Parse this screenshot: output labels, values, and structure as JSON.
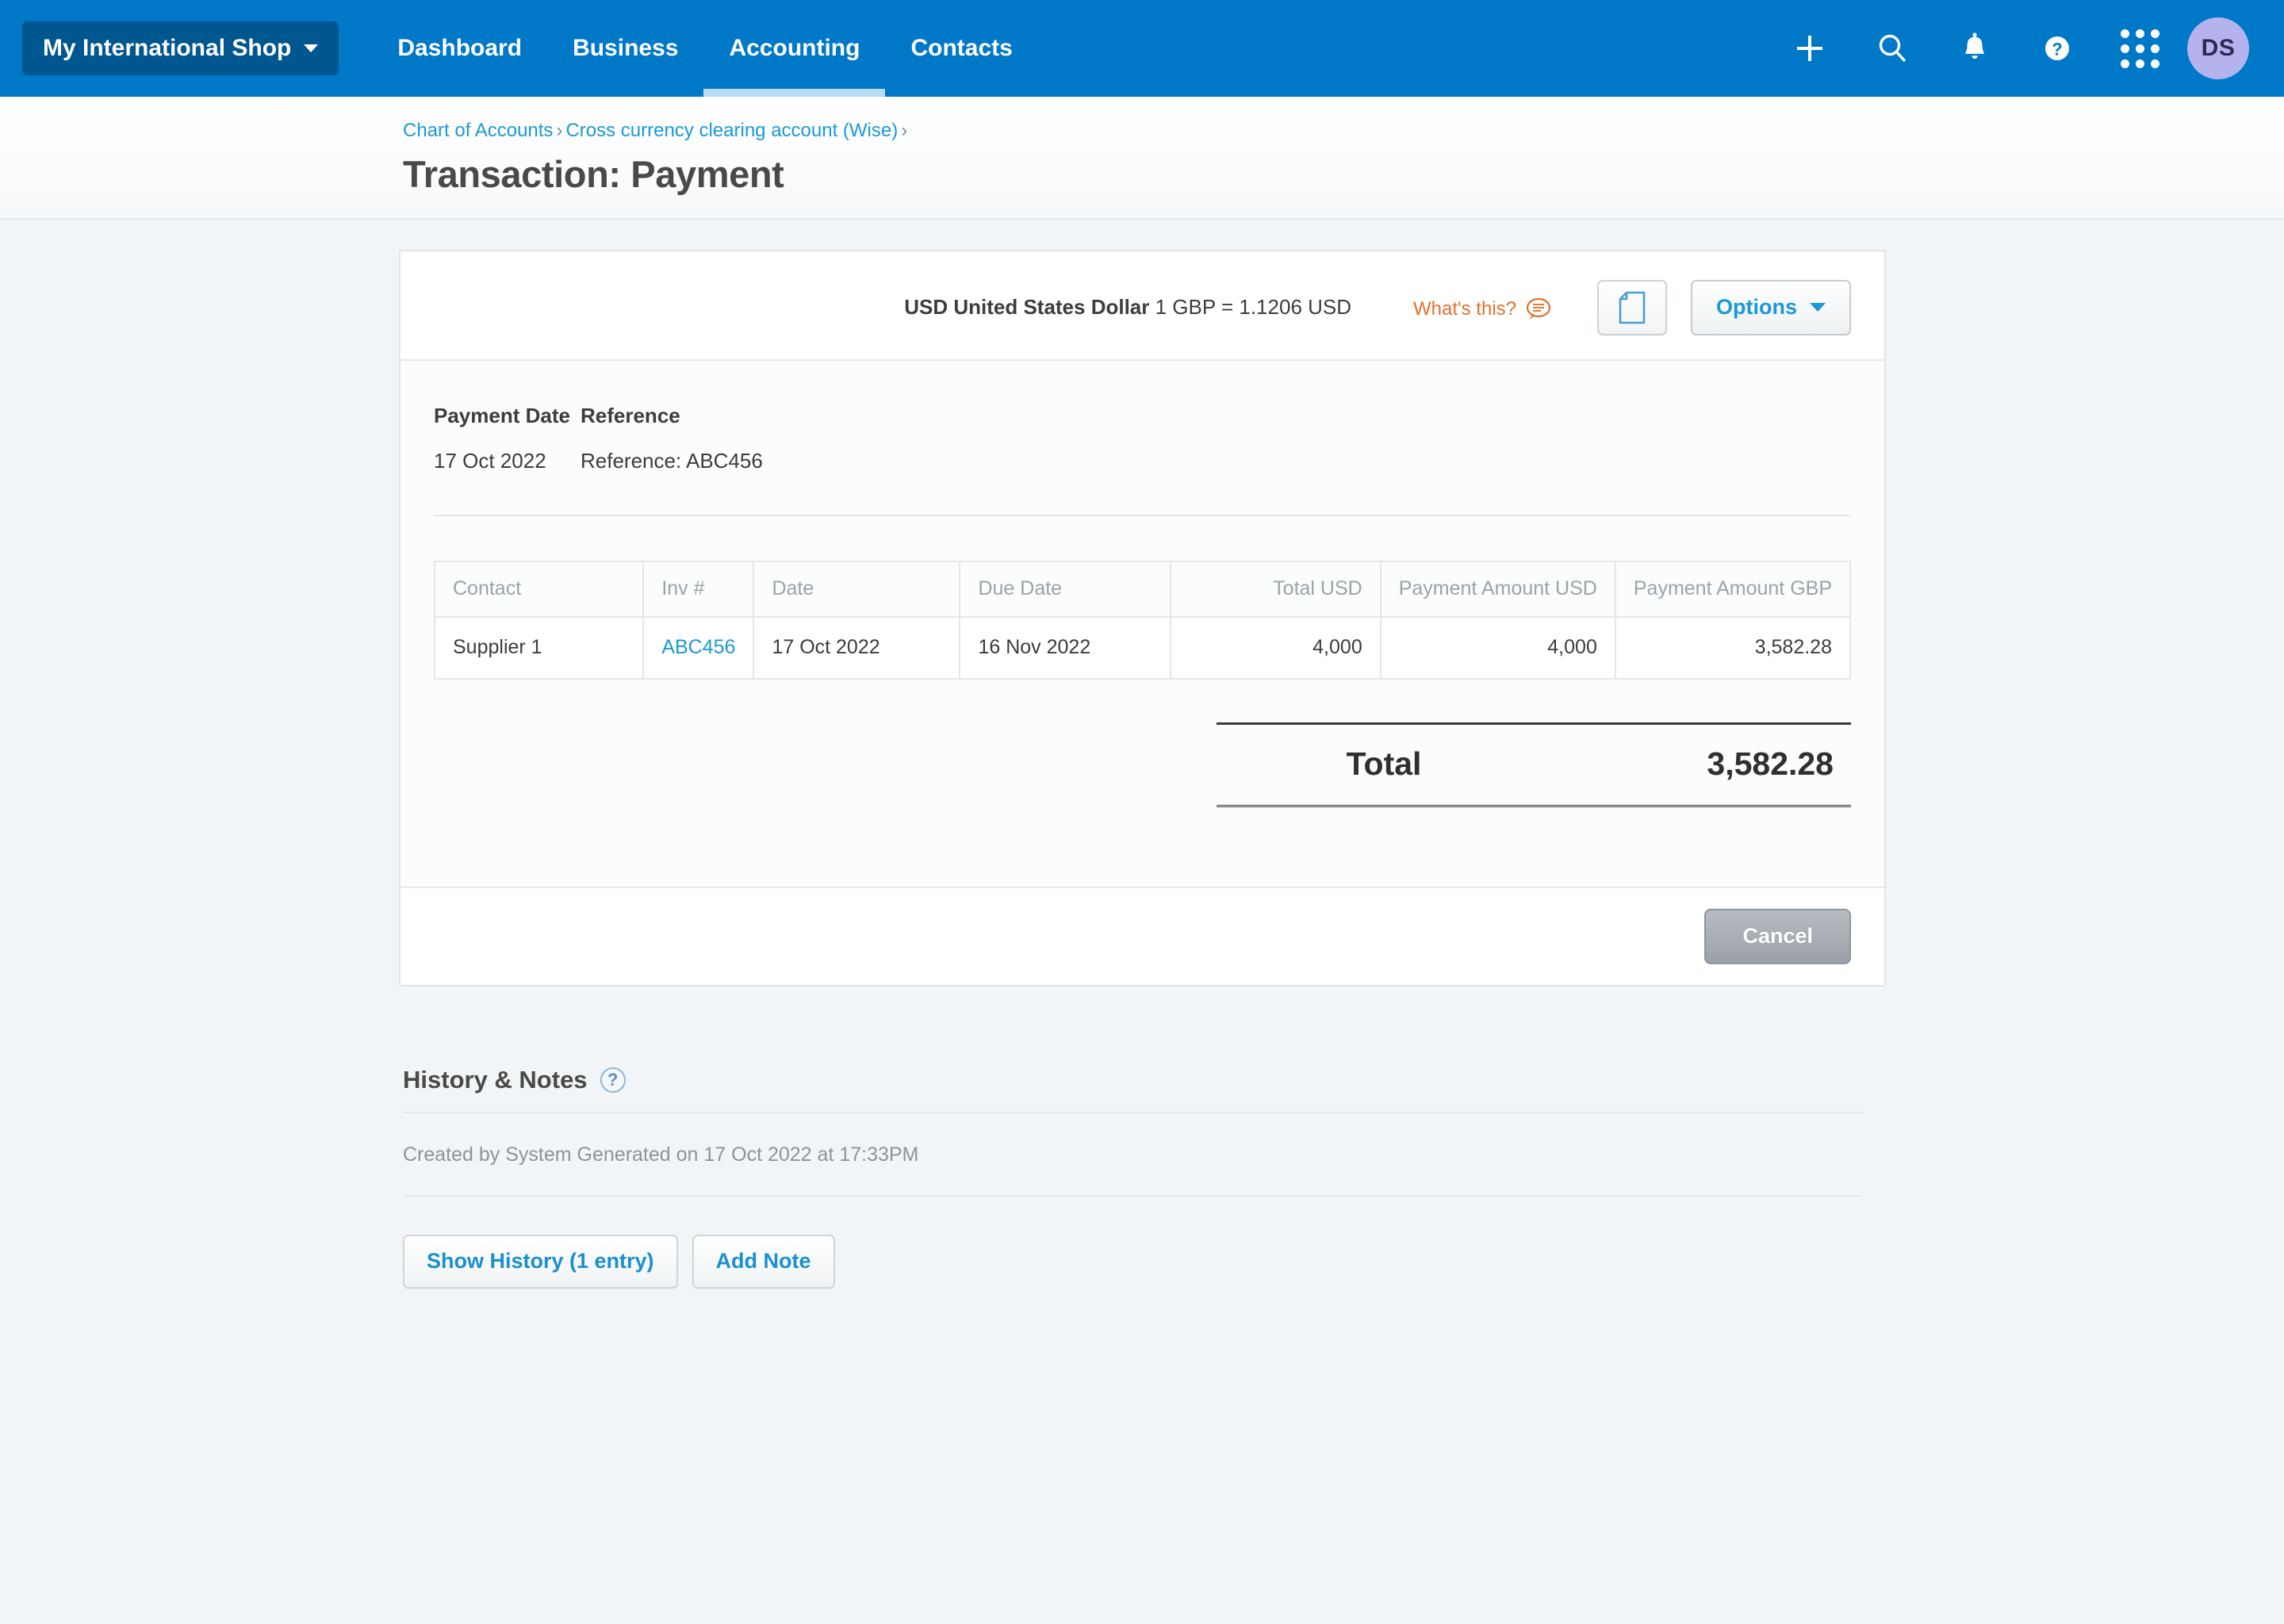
{
  "colors": {
    "nav_blue": "#0078c8",
    "org_blue": "#00568f",
    "link_blue": "#1b99d5",
    "accent_orange": "#e0702a",
    "avatar_bg": "#b5b3ee",
    "page_bg": "#f2f5f7"
  },
  "topnav": {
    "org_name": "My International Shop",
    "links": [
      {
        "label": "Dashboard",
        "active": false
      },
      {
        "label": "Business",
        "active": false
      },
      {
        "label": "Accounting",
        "active": true
      },
      {
        "label": "Contacts",
        "active": false
      }
    ],
    "icons": [
      "plus-icon",
      "search-icon",
      "bell-icon",
      "help-icon",
      "apps-grid-icon"
    ],
    "avatar_initials": "DS"
  },
  "page_header": {
    "breadcrumb": [
      {
        "label": "Chart of Accounts"
      },
      {
        "label": "Cross currency clearing account (Wise)"
      }
    ],
    "separator": "›",
    "title": "Transaction: Payment"
  },
  "card": {
    "currency_code_name": "USD United States Dollar",
    "exchange_rate": "1 GBP = 1.1206  USD",
    "whats_this_label": "What's this?",
    "whats_this_icon": "speech-bubble-icon",
    "file_icon": "document-icon",
    "options_label": "Options",
    "meta": {
      "labels": [
        "Payment Date",
        "Reference"
      ],
      "values": [
        "17 Oct 2022",
        "Reference: ABC456"
      ]
    },
    "table": {
      "columns": [
        {
          "label": "Contact",
          "align": "left"
        },
        {
          "label": "Inv #",
          "align": "left"
        },
        {
          "label": "Date",
          "align": "left"
        },
        {
          "label": "Due Date",
          "align": "left"
        },
        {
          "label": "Total USD",
          "align": "right"
        },
        {
          "label": "Payment Amount USD",
          "align": "right"
        },
        {
          "label": "Payment Amount GBP",
          "align": "right"
        }
      ],
      "rows": [
        {
          "contact": "Supplier 1",
          "invoice": "ABC456",
          "date": "17 Oct 2022",
          "due_date": "16 Nov 2022",
          "total_usd": "4,000",
          "payment_amount_usd": "4,000",
          "payment_amount_gbp": "3,582.28"
        }
      ],
      "total_label": "Total",
      "total_value": "3,582.28"
    },
    "cancel_label": "Cancel"
  },
  "history": {
    "title": "History & Notes",
    "help_icon_label": "?",
    "entry": "Created by System Generated on 17 Oct 2022 at 17:33PM",
    "show_history_label": "Show History (1 entry)",
    "add_note_label": "Add Note"
  }
}
